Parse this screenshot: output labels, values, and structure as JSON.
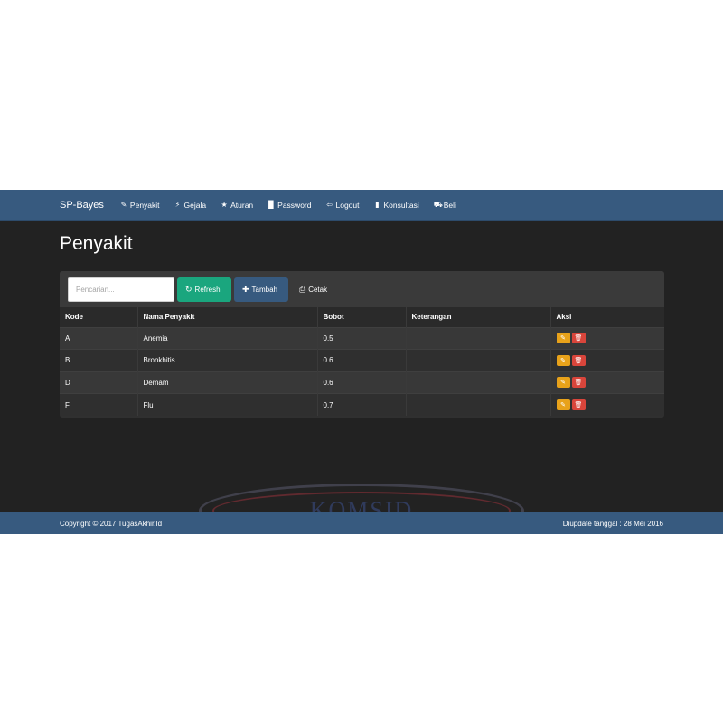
{
  "navbar": {
    "brand": "SP-Bayes",
    "items": [
      {
        "icon": "pin-icon",
        "glyph": "✎",
        "label": "Penyakit"
      },
      {
        "icon": "bolt-icon",
        "glyph": "⚡",
        "label": "Gejala"
      },
      {
        "icon": "star-icon",
        "glyph": "★",
        "label": "Aturan"
      },
      {
        "icon": "lock-icon",
        "glyph": "▉",
        "label": "Password"
      },
      {
        "icon": "logout-icon",
        "glyph": "⇦",
        "label": "Logout"
      },
      {
        "icon": "chart-icon",
        "glyph": "▮",
        "label": "Konsultasi"
      },
      {
        "icon": "cart-icon",
        "glyph": "⛟",
        "label": "Beli"
      }
    ]
  },
  "page": {
    "title": "Penyakit"
  },
  "toolbar": {
    "search_placeholder": "Pencarian...",
    "refresh_label": "Refresh",
    "tambah_label": "Tambah",
    "cetak_label": "Cetak"
  },
  "table": {
    "headers": [
      "Kode",
      "Nama Penyakit",
      "Bobot",
      "Keterangan",
      "Aksi"
    ],
    "rows": [
      {
        "kode": "A",
        "nama": "Anemia",
        "bobot": "0.5",
        "keterangan": ""
      },
      {
        "kode": "B",
        "nama": "Bronkhitis",
        "bobot": "0.6",
        "keterangan": ""
      },
      {
        "kode": "D",
        "nama": "Demam",
        "bobot": "0.6",
        "keterangan": ""
      },
      {
        "kode": "F",
        "nama": "Flu",
        "bobot": "0.7",
        "keterangan": ""
      }
    ]
  },
  "footer": {
    "copyright": "Copyright © 2017 TugasAkhir.Id",
    "updated": "Diupdate tanggal : 28 Mei 2016"
  },
  "watermark": {
    "text": "KOMSID"
  },
  "colors": {
    "navbar": "#375a7f",
    "background": "#222222",
    "refresh": "#1aa67e",
    "edit": "#e8a21a",
    "delete": "#d9453b"
  }
}
